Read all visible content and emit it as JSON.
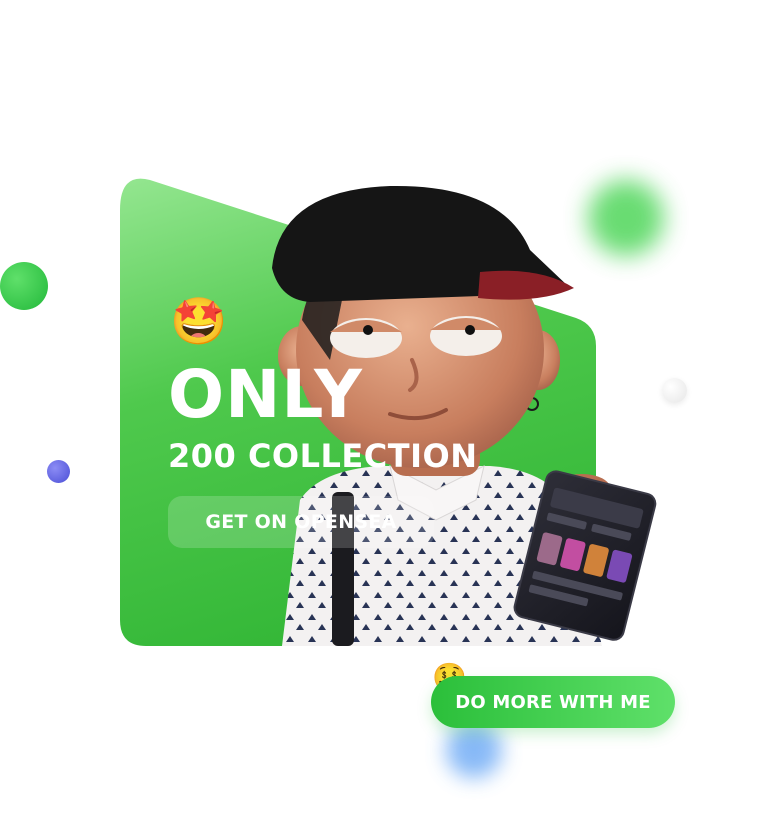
{
  "hero": {
    "emoji_top": "🤩",
    "title": "ONLY",
    "subtitle": "200 COLLECTION",
    "cta_label": "GET ON OPENSEA"
  },
  "secondary": {
    "emoji": "🤑",
    "cta_label": "DO MORE WITH ME"
  },
  "colors": {
    "card_green": "#3ebd3f",
    "card_green_light": "#8fe48a",
    "accent_green": "#2bbf3a",
    "purple_dot": "#4b4fd6",
    "blue_glow": "#6aa8f5"
  },
  "icons": {
    "emoji_top": "star-struck-face-icon",
    "emoji_money": "money-mouth-face-icon"
  }
}
